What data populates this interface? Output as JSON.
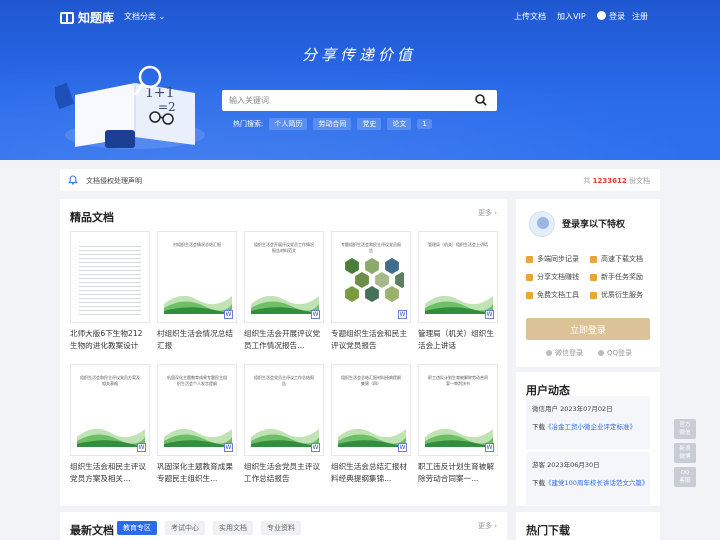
{
  "header": {
    "logo_text": "知题库",
    "category_menu": "文档分类",
    "upload": "上传文档",
    "vip": "加入VIP",
    "login": "登录",
    "register": "注册",
    "slogan": "分享传递价值"
  },
  "search": {
    "placeholder": "输入关键词",
    "hot_label": "热门搜索:",
    "hot_terms": [
      "个人简历",
      "劳动合同",
      "党史",
      "论文",
      "1"
    ]
  },
  "notice": {
    "text": "文档侵权处理声明",
    "count_prefix": "共",
    "count": "1233612",
    "count_suffix": "份文档"
  },
  "featured": {
    "title": "精品文档",
    "more": "更多",
    "docs": [
      {
        "name": "北师大版6下生物212生物的进化教案设计",
        "thumb_title": ""
      },
      {
        "name": "村组织生活会情况总结汇报",
        "thumb_title": "村组织生活会情况总结汇报"
      },
      {
        "name": "组织生活会开展评议党员工作情况报告...",
        "thumb_title": "组织生活会开展评议党员工作情况报告材料范文"
      },
      {
        "name": "专题组织生活会和民主评议党员报告",
        "thumb_title": "专题组织生活会和民主评议党员报告"
      },
      {
        "name": "管理局（机关）组织生活会上讲话",
        "thumb_title": "管理局（机关）组织生活会上讲话"
      },
      {
        "name": "组织生活会和民主评议党员方案及相关...",
        "thumb_title": "组织生活会和民主评议党员方案及相关表格"
      },
      {
        "name": "巩固深化主题教育成果专题民主组织生...",
        "thumb_title": "巩固深化主题教育成果专题民主组织生活会个人发言提纲"
      },
      {
        "name": "组织生活会党员主评议工作总结报告",
        "thumb_title": "组织生活会党员主评议工作总结报告"
      },
      {
        "name": "组织生活会总结汇报材料经典提纲集锦...",
        "thumb_title": "组织生活会总结汇报材料经典提纲集锦（四）"
      },
      {
        "name": "职工违反计划生育被解除劳动合同案一...",
        "thumb_title": "职工违反计划生育被解除劳动合同案一审判决书"
      }
    ],
    "word_badge": "W"
  },
  "latest": {
    "title": "最新文档",
    "more": "更多",
    "tabs": [
      "教育专区",
      "考试中心",
      "实用文档",
      "专业资料"
    ]
  },
  "login_panel": {
    "title": "登录享以下特权",
    "features": [
      "多端同步记录",
      "高速下载文档",
      "分享文档赚钱",
      "新手任务奖励",
      "免费文档工具",
      "优质衍生服务"
    ],
    "button": "立即登录",
    "wechat": "微信登录",
    "qq": "QQ登录"
  },
  "activity": {
    "title": "用户动态",
    "items": [
      {
        "who": "微信用户 2023年07月02日",
        "action": "下载",
        "doc": "《冶金工贸小微企业评定标准》"
      },
      {
        "who": "游客 2023年06月30日",
        "action": "下载",
        "doc": "《建党100周年校长讲话范文六篇》"
      }
    ]
  },
  "hot_downloads": {
    "title": "热门下载"
  },
  "float_tools": [
    "官方\n微信",
    "新浪\n微博",
    "QQ\n客服"
  ],
  "colors": {
    "primary": "#2a6bea",
    "login_button": "#dcc397",
    "count": "#e53935"
  }
}
